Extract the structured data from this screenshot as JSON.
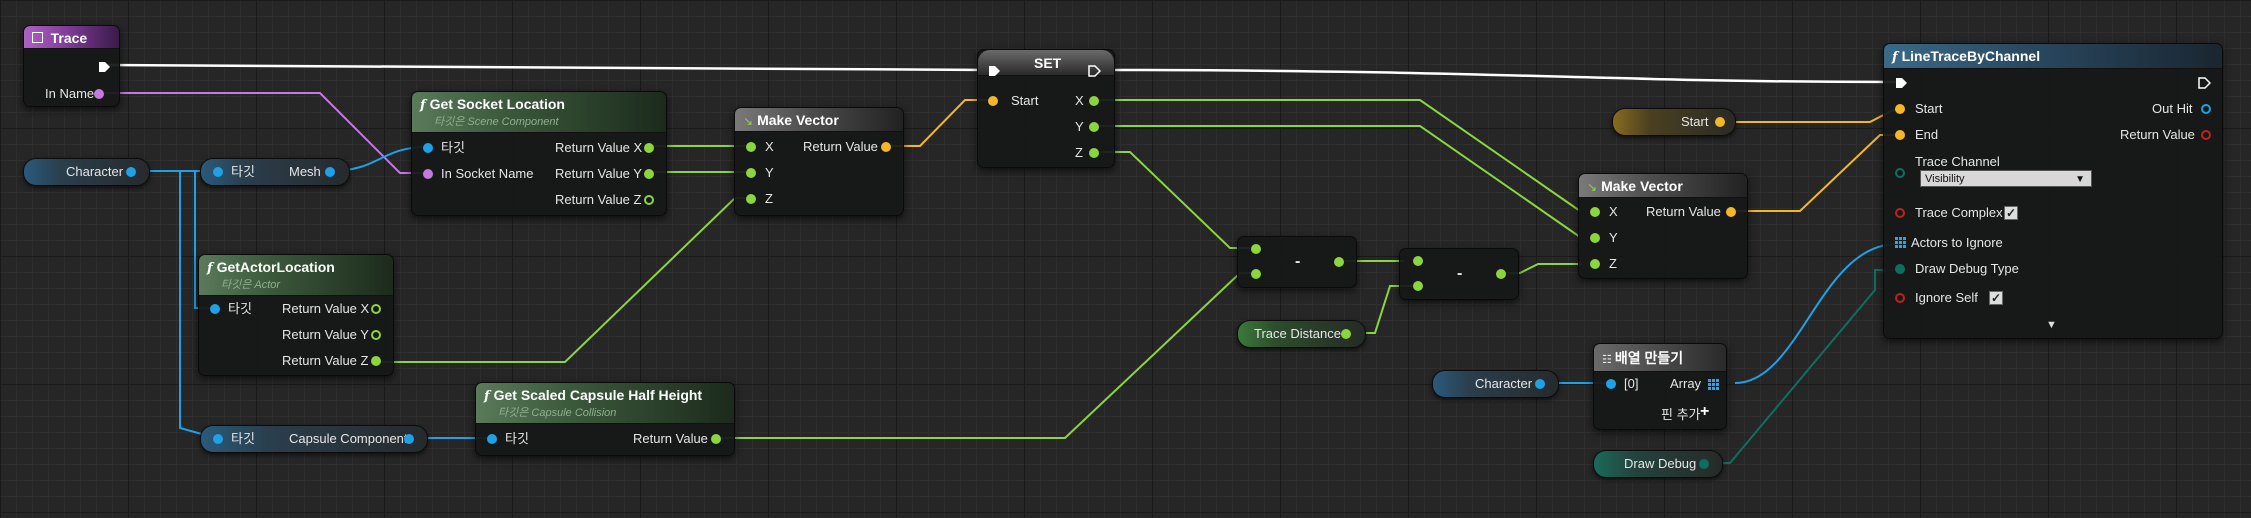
{
  "colors": {
    "exec": "#ffffff",
    "vector_float": "#8bd53f",
    "struct_vector": "#f5b72a",
    "object": "#1ea1e6",
    "name": "#c27ae0",
    "bool": "#c02020",
    "enum": "#0e6f5f"
  },
  "nodes": {
    "trace_event": {
      "title": "Trace",
      "in_name": "In Name"
    },
    "get_socket_location": {
      "title": "Get Socket Location",
      "subtitle": "타깃은 Scene Component",
      "target": "타깃",
      "in_socket_name": "In Socket Name",
      "return_x": "Return Value X",
      "return_y": "Return Value Y",
      "return_z": "Return Value Z"
    },
    "make_vector_1": {
      "title": "Make Vector",
      "x": "X",
      "y": "Y",
      "z": "Z",
      "return": "Return Value"
    },
    "set_node": {
      "title": "SET",
      "start": "Start",
      "x": "X",
      "y": "Y",
      "z": "Z"
    },
    "get_actor_location": {
      "title": "GetActorLocation",
      "subtitle": "타깃은 Actor",
      "target": "타깃",
      "return_x": "Return Value X",
      "return_y": "Return Value Y",
      "return_z": "Return Value Z"
    },
    "get_capsule_half_height": {
      "title": "Get Scaled Capsule Half Height",
      "subtitle": "타깃은 Capsule Collision",
      "target": "타깃",
      "return": "Return Value"
    },
    "subtract_1": {
      "op": "-"
    },
    "subtract_2": {
      "op": "-"
    },
    "make_vector_2": {
      "title": "Make Vector",
      "x": "X",
      "y": "Y",
      "z": "Z",
      "return": "Return Value"
    },
    "make_array": {
      "title": "배열 만들기",
      "item0": "[0]",
      "array": "Array",
      "add_pin": "핀 추가"
    },
    "line_trace": {
      "title": "LineTraceByChannel",
      "start": "Start",
      "end": "End",
      "trace_channel": "Trace Channel",
      "trace_channel_value": "Visibility",
      "trace_complex": "Trace Complex",
      "actors_to_ignore": "Actors to Ignore",
      "draw_debug_type": "Draw Debug Type",
      "ignore_self": "Ignore Self",
      "out_hit": "Out Hit",
      "return": "Return Value"
    }
  },
  "variables": {
    "character_1": "Character",
    "mesh_target": "타깃",
    "mesh": "Mesh",
    "capsule_target": "타깃",
    "capsule": "Capsule Component",
    "start_var": "Start",
    "trace_distance": "Trace Distance",
    "character_2": "Character",
    "draw_debug": "Draw Debug"
  }
}
